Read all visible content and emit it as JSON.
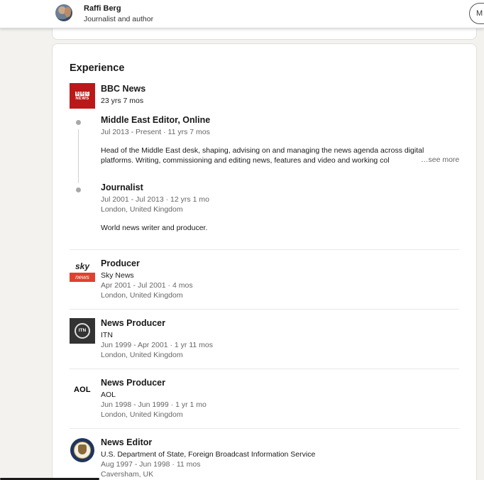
{
  "header": {
    "name": "Raffi Berg",
    "headline": "Journalist and author",
    "button_label": "M"
  },
  "experience": {
    "title": "Experience",
    "see_more_label": "…see more",
    "bbc": {
      "company": "BBC News",
      "total_duration": "23 yrs 7 mos",
      "logo_letters": [
        "B",
        "B",
        "C"
      ],
      "logo_word": "NEWS",
      "roles": [
        {
          "title": "Middle East Editor, Online",
          "dates": "Jul 2013 - Present · 11 yrs 7 mos",
          "description_line1": "Head of the Middle East desk, shaping, advising on and managing the news agenda across digital",
          "description_line2": "platforms. Writing, commissioning and editing news, features and video and working col"
        },
        {
          "title": "Journalist",
          "dates": "Jul 2001 - Jul 2013 · 12 yrs 1 mo",
          "location": "London, United Kingdom",
          "description": "World news writer and producer."
        }
      ]
    },
    "positions": [
      {
        "title": "Producer",
        "company": "Sky News",
        "dates": "Apr 2001 - Jul 2001 · 4 mos",
        "location": "London, United Kingdom",
        "logo_word": "sky",
        "logo_sub": "news"
      },
      {
        "title": "News Producer",
        "company": "ITN",
        "dates": "Jun 1999 - Apr 2001 · 1 yr 11 mos",
        "location": "London, United Kingdom",
        "logo_word": "ITN"
      },
      {
        "title": "News Producer",
        "company": "AOL",
        "dates": "Jun 1998 - Jun 1999 · 1 yr 1 mo",
        "location": "London, United Kingdom",
        "logo_word": "AOL"
      },
      {
        "title": "News Editor",
        "company": "U.S. Department of State, Foreign Broadcast Information Service",
        "dates": "Aug 1997 - Jun 1998 · 11 mos",
        "location": "Caversham, UK"
      }
    ]
  },
  "colors": {
    "page_bg": "#f3f2ef",
    "card_bg": "#ffffff",
    "bbc_red": "#bb1919",
    "sky_red": "#e0412d",
    "meta_gray": "#666666"
  }
}
